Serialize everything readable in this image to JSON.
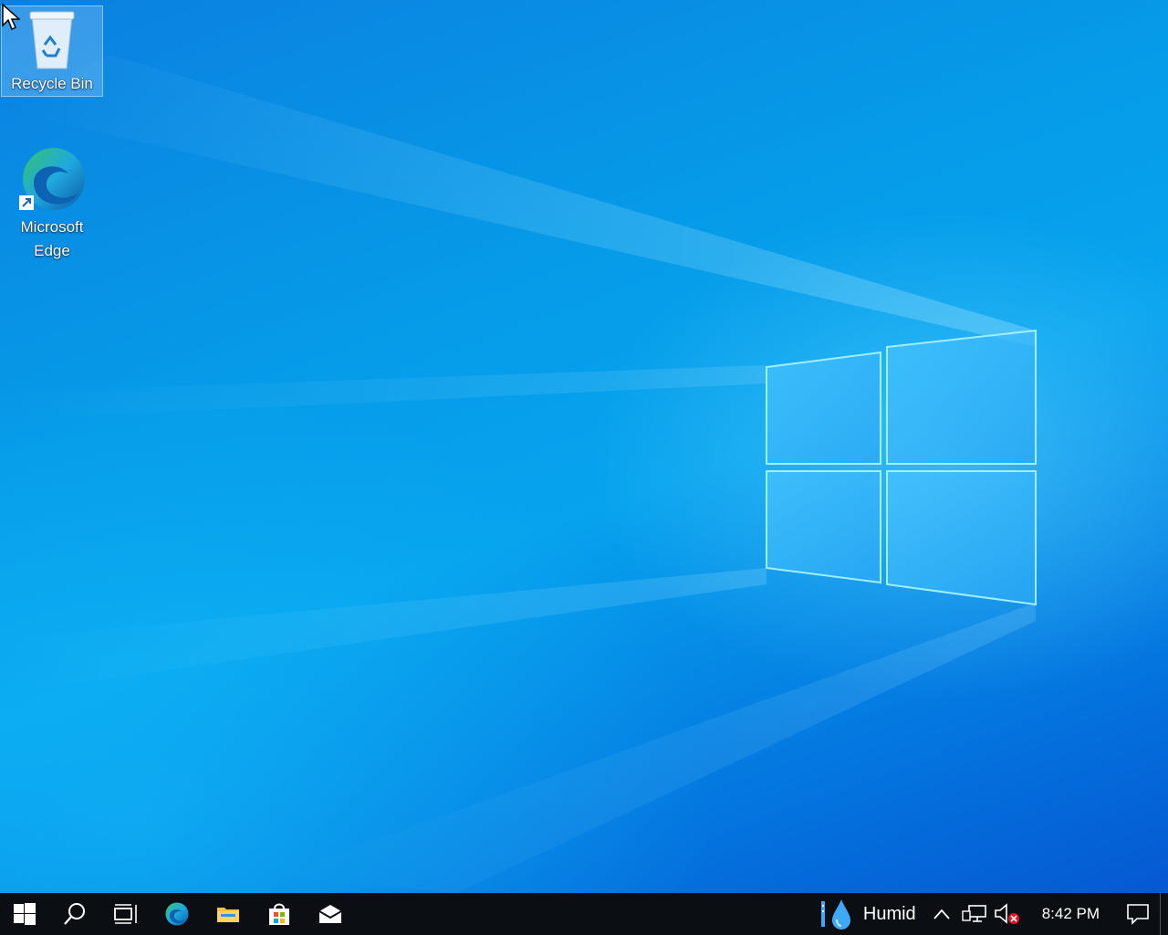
{
  "desktop": {
    "icons": [
      {
        "label": "Recycle Bin",
        "icon": "recycle-bin-icon"
      },
      {
        "label": "Microsoft Edge",
        "icon": "edge-icon"
      }
    ]
  },
  "taskbar": {
    "buttons": [
      {
        "name": "start-button",
        "icon": "windows-logo-icon"
      },
      {
        "name": "search-button",
        "icon": "search-icon"
      },
      {
        "name": "task-view-button",
        "icon": "task-view-icon"
      },
      {
        "name": "edge-taskbar-button",
        "icon": "edge-icon"
      },
      {
        "name": "file-explorer-button",
        "icon": "folder-icon"
      },
      {
        "name": "store-button",
        "icon": "store-icon"
      },
      {
        "name": "mail-button",
        "icon": "mail-icon"
      }
    ],
    "weather": {
      "text": "Humid",
      "icon": "raindrop-icon"
    },
    "tray": {
      "chevron_icon": "chevron-up-icon",
      "network_icon": "network-icon",
      "volume_icon": "volume-muted-icon"
    },
    "clock": "8:42 PM",
    "notification_icon": "notification-icon"
  },
  "colors": {
    "taskbar_bg": "#0b0f14",
    "wallpaper_accent": "#0a78d8"
  }
}
